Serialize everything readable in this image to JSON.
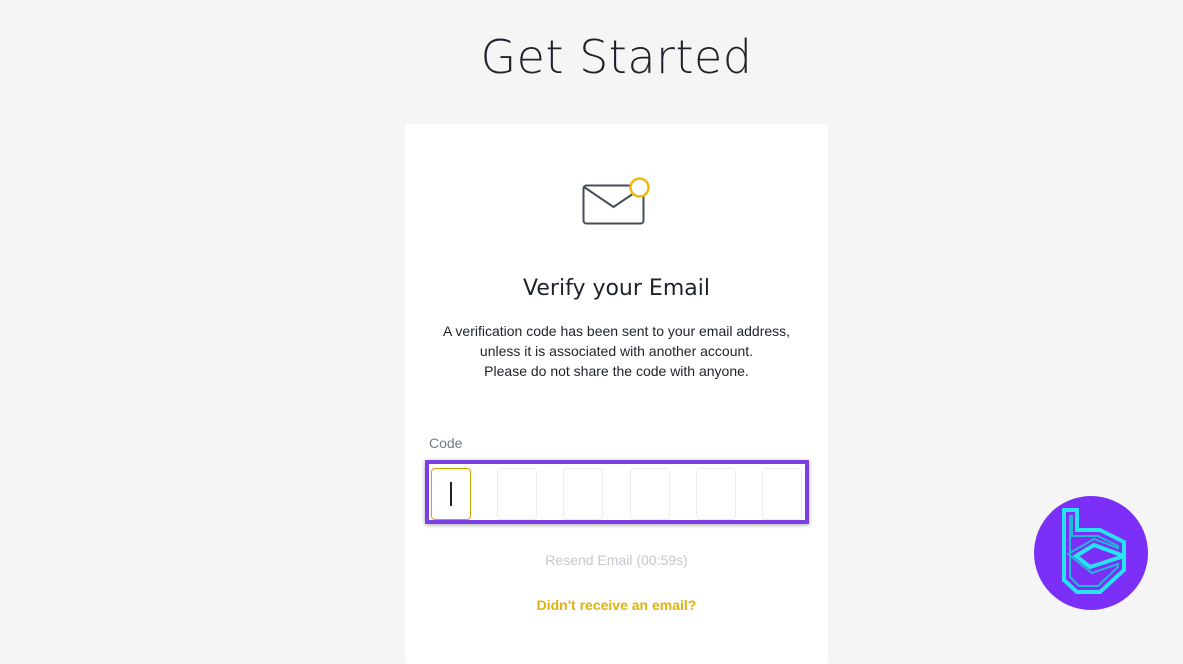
{
  "page": {
    "title": "Get Started"
  },
  "card": {
    "heading": "Verify your Email",
    "description_lines": [
      "A verification code has been sent to your email address,",
      "unless it is associated with another account.",
      "Please do not share the code with anyone."
    ],
    "code_label": "Code",
    "code_values": [
      "",
      "",
      "",
      "",
      "",
      ""
    ],
    "resend_label": "Resend Email (00:59s)",
    "no_email_link": "Didn't receive an email?"
  },
  "icons": {
    "mail": "envelope-icon",
    "brand": "brand-logo"
  },
  "colors": {
    "accent": "#f0b90b",
    "highlight_border": "#7b3fe4",
    "brand_purple": "#7b2ff7",
    "brand_cyan": "#27e3f2"
  }
}
